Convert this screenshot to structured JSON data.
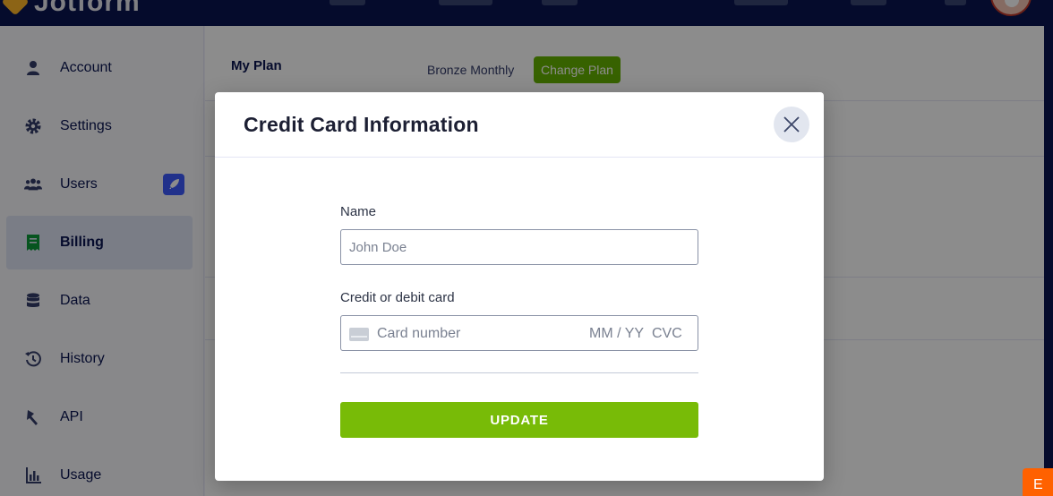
{
  "app": {
    "brand": "Jotform"
  },
  "sidebar": {
    "items": [
      {
        "label": "Account",
        "icon": "user-icon"
      },
      {
        "label": "Settings",
        "icon": "gear-icon"
      },
      {
        "label": "Users",
        "icon": "users-icon",
        "badge_icon": "rocket-icon"
      },
      {
        "label": "Billing",
        "icon": "receipt-icon",
        "active": true
      },
      {
        "label": "Data",
        "icon": "database-icon"
      },
      {
        "label": "History",
        "icon": "history-icon"
      },
      {
        "label": "API",
        "icon": "api-icon"
      },
      {
        "label": "Usage",
        "icon": "bar-chart-icon"
      }
    ]
  },
  "billing": {
    "my_plan_label": "My Plan",
    "plan_value": "Bronze Monthly",
    "change_plan_label": "Change Plan"
  },
  "modal": {
    "title": "Credit Card Information",
    "name_label": "Name",
    "name_placeholder": "John Doe",
    "card_label": "Credit or debit card",
    "card_number_placeholder": "Card number",
    "card_expiry_placeholder": "MM / YY",
    "card_cvc_placeholder": "CVC",
    "update_label": "UPDATE"
  },
  "colors": {
    "accent_green": "#78bb07",
    "nav_dark": "#0a1551",
    "corner_orange": "#ff6100"
  }
}
